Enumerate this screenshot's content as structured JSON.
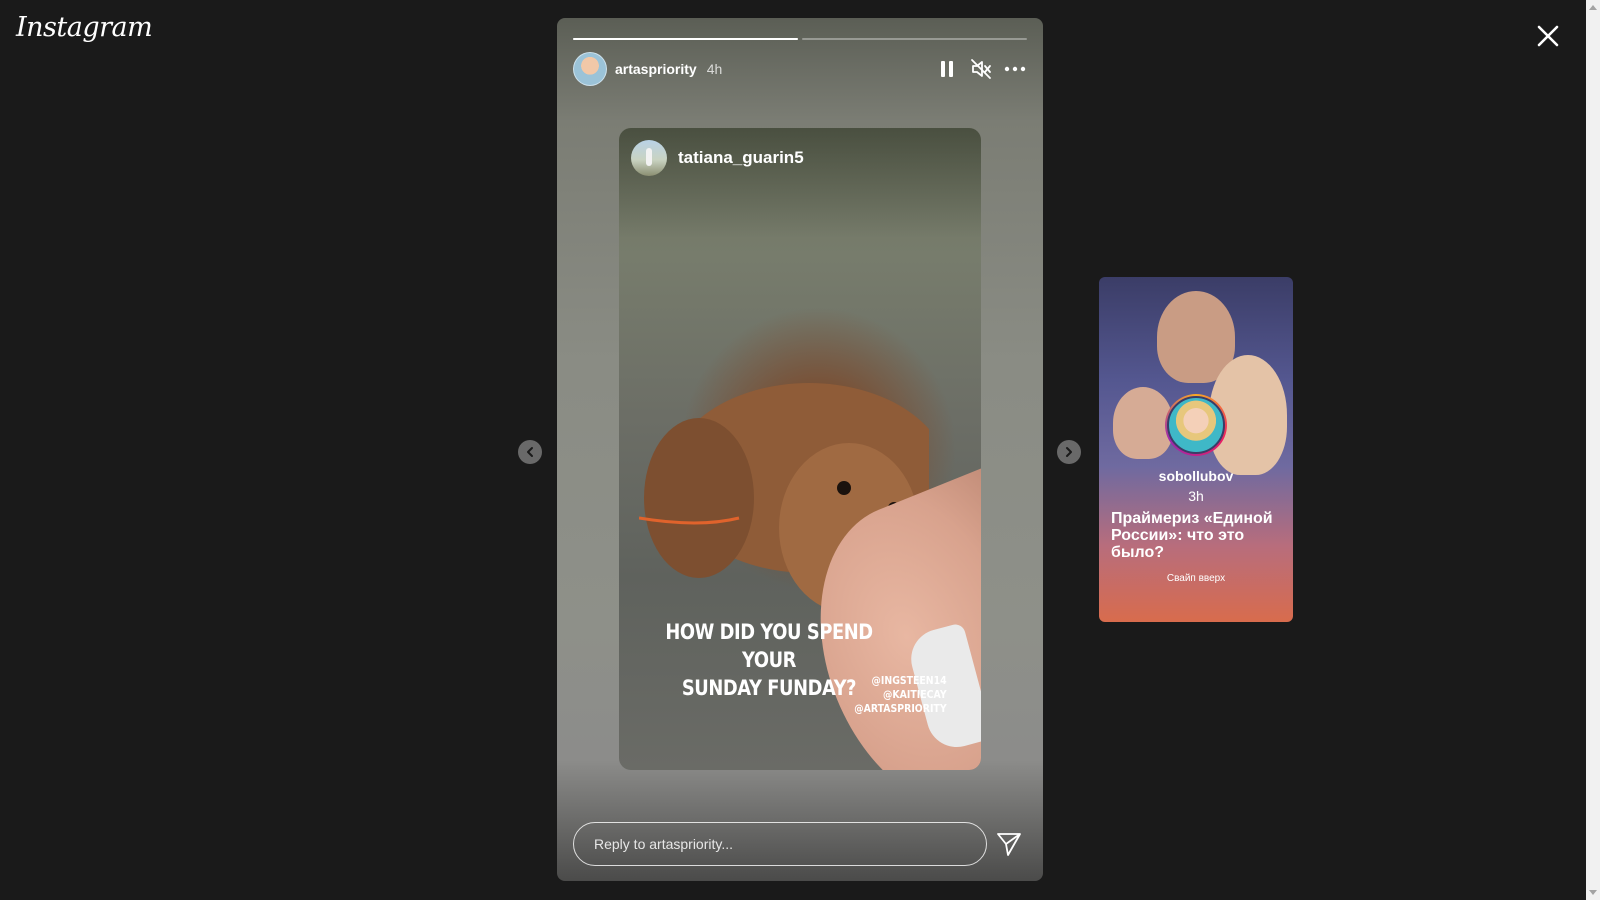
{
  "app": {
    "logo_text": "Instagram"
  },
  "story": {
    "username": "artaspriority",
    "time": "4h",
    "progress": [
      1.0,
      0.0
    ],
    "shared_post": {
      "username": "tatiana_guarin5",
      "caption_line1": "HOW DID YOU SPEND YOUR",
      "caption_line2": "SUNDAY FUNDAY?",
      "mentions": [
        "@INGSTEEN14",
        "@KAITIECAY",
        "@ARTASPRIORITY"
      ]
    },
    "reply_placeholder": "Reply to artaspriority..."
  },
  "next_story": {
    "username": "sobollubov",
    "time": "3h",
    "headline": "Праймериз «Единой России»: что это было?",
    "swipe_text": "Свайп вверх"
  },
  "icons": {
    "close": "close-icon",
    "pause": "pause-icon",
    "mute": "muted-speaker-icon",
    "more": "more-horizontal-icon",
    "send": "send-icon",
    "prev": "chevron-left-icon",
    "next": "chevron-right-icon"
  }
}
